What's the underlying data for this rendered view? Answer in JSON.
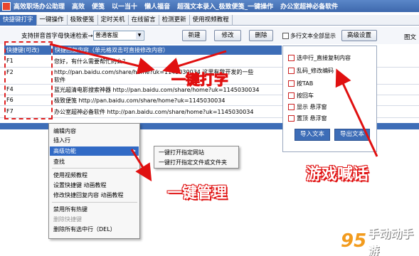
{
  "window": {
    "title_parts": [
      "高效职场办公助理",
      "高效",
      "便笺",
      "以一当十",
      "懒人福音",
      "超强文本录入_极致便笺_一键操作",
      "办公室超神必备软件"
    ]
  },
  "tabs": [
    {
      "label": "快捷键打字",
      "active": true
    },
    {
      "label": "一键操作",
      "active": false
    },
    {
      "label": "极致便笺",
      "active": false
    },
    {
      "label": "定时关机",
      "active": false
    },
    {
      "label": "在线留言",
      "active": false
    },
    {
      "label": "检测更新",
      "active": false
    },
    {
      "label": "使用视频教程",
      "active": false
    }
  ],
  "toolbar": {
    "search_label": "支持拼音首字母快速检索→",
    "search_value": "普通客服",
    "new_label": "新建",
    "edit_label": "修改",
    "delete_label": "删除",
    "multi_select_label": "多行文本全部显示",
    "advanced_label": "高级设置",
    "right_cut_label": "图文"
  },
  "table": {
    "col_key_header": "快捷键(可改)",
    "col_content_header": "快捷回复内容（单元格双击可直接修改内容）",
    "rows": [
      {
        "key": "F1",
        "content": "您好，有什么需要帮忙的么？",
        "content2": ""
      },
      {
        "key": "F2",
        "content": "http://pan.baidu.com/share/home?uk=1145030034  这里有我开发的一些",
        "content2": "软件"
      },
      {
        "key": "F4",
        "content": "蓝光超清电影搜索神器 http://pan.baidu.com/share/home?uk=1145030034",
        "content2": ""
      },
      {
        "key": "F6",
        "content": "极致便笺 http://pan.baidu.com/share/home?uk=1145030034",
        "content2": ""
      },
      {
        "key": "F7",
        "content": "办公室超神必备软件 http://pan.baidu.com/share/home?uk=1145030034",
        "content2": ""
      }
    ]
  },
  "context_menu": {
    "items": [
      "编辑内容",
      "插入行",
      "高级功能",
      "查找",
      "使用视频教程",
      "设置快捷键 动画教程",
      "修改快捷回复内容 动画教程",
      "禁用所有热键",
      "删除快捷键",
      "删除所有选中行（DEL）"
    ],
    "submenu": [
      "一键打开指定网站",
      "一键打开指定文件或文件夹"
    ]
  },
  "settings_panel": {
    "options": [
      {
        "label": "选中行_直接复制内容",
        "checked": false
      },
      {
        "label": "乱码_修改编码",
        "checked": false
      },
      {
        "label": "按TAB",
        "checked": false
      },
      {
        "label": "按回车",
        "checked": false
      },
      {
        "label": "显示 悬浮窗",
        "checked": false
      },
      {
        "label": "置顶 悬浮窗",
        "checked": false
      }
    ],
    "import_label": "导入文本",
    "export_label": "导出文本"
  },
  "annotations": {
    "one_key_typing": "一键打字",
    "one_key_manage": "一键管理",
    "game_chat": "游戏喊话"
  },
  "watermark": {
    "number": "95",
    "text": "手动动手游"
  },
  "colors": {
    "accent_blue": "#3d6db7",
    "annotation_red": "#e01010",
    "watermark_orange": "#f29b1d"
  }
}
